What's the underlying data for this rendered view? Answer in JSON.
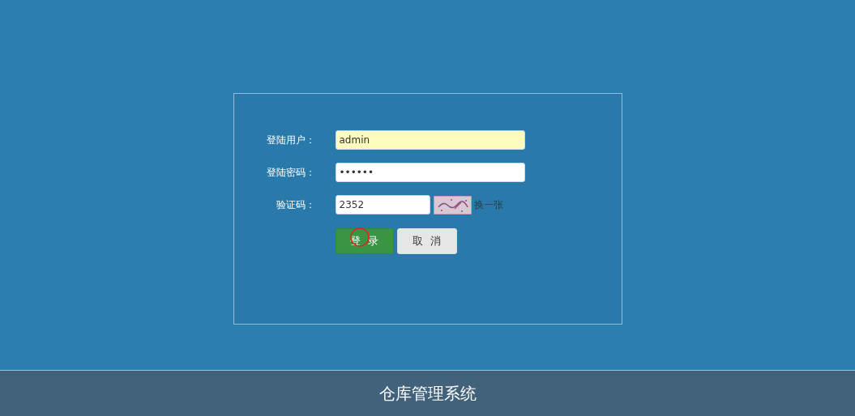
{
  "form": {
    "fields": [
      {
        "label": "登陆用户：",
        "value": "admin",
        "kind": "text",
        "highlighted": true
      },
      {
        "label": "登陆密码：",
        "value": "••••••",
        "kind": "text",
        "highlighted": false
      },
      {
        "label": "验证码：",
        "value": "2352",
        "kind": "captcha",
        "highlighted": false
      }
    ],
    "refresh_link": "换一张",
    "buttons": [
      {
        "label": "登  录",
        "kind": "primary"
      },
      {
        "label": "取  消",
        "kind": "secondary"
      }
    ]
  },
  "footer": {
    "title": "仓库管理系统"
  }
}
